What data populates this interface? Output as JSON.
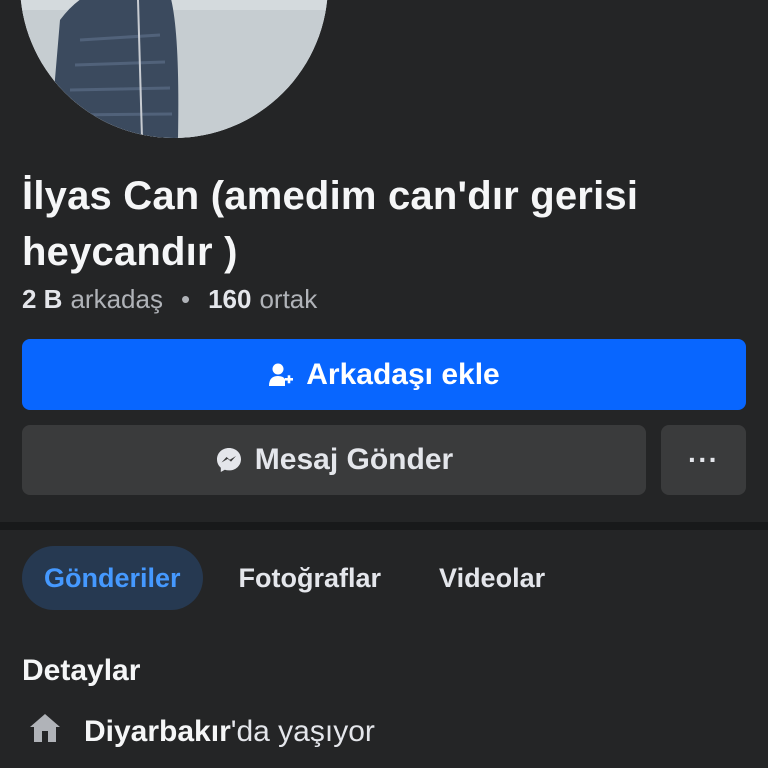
{
  "profile": {
    "name": "İlyas Can (amedim can'dır gerisi heycandır )",
    "friends_count": "2 B",
    "friends_label": "arkadaş",
    "mutual_count": "160",
    "mutual_label": "ortak"
  },
  "actions": {
    "add_friend_label": "Arkadaşı ekle",
    "message_label": "Mesaj Gönder",
    "more_label": "···"
  },
  "tabs": [
    {
      "label": "Gönderiler",
      "active": true
    },
    {
      "label": "Fotoğraflar",
      "active": false
    },
    {
      "label": "Videolar",
      "active": false
    }
  ],
  "details": {
    "title": "Detaylar",
    "location_city": "Diyarbakır",
    "location_suffix": "'da yaşıyor"
  },
  "icons": {
    "add_friend": "person-add-icon",
    "message": "messenger-icon",
    "home": "home-icon"
  },
  "colors": {
    "background": "#242526",
    "primary_button": "#0866ff",
    "secondary_button": "#3a3b3c",
    "active_tab_bg": "#263951",
    "active_tab_text": "#4599ff"
  }
}
